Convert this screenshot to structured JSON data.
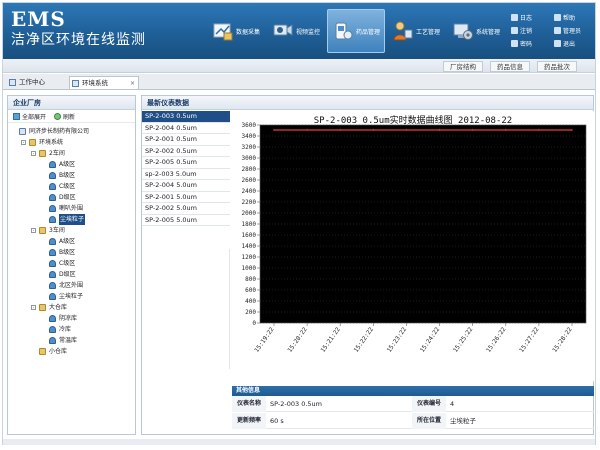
{
  "header": {
    "brand": "EMS",
    "subtitle": "洁净区环境在线监测",
    "modules": [
      {
        "label": "数据采集",
        "icon": "data-collect-icon",
        "active": false
      },
      {
        "label": "视频监控",
        "icon": "video-monitor-icon",
        "active": false
      },
      {
        "label": "药品管理",
        "icon": "drug-manage-icon",
        "active": true
      },
      {
        "label": "工艺管理",
        "icon": "process-manage-icon",
        "active": false
      },
      {
        "label": "系统管理",
        "icon": "system-manage-icon",
        "active": false
      }
    ],
    "utilities": [
      {
        "label": "日志",
        "icon": "log-icon"
      },
      {
        "label": "帮助",
        "icon": "help-icon"
      },
      {
        "label": "注销",
        "icon": "logout-icon"
      },
      {
        "label": "管理员",
        "icon": "admin-icon"
      },
      {
        "label": "密码",
        "icon": "password-icon"
      },
      {
        "label": "退出",
        "icon": "exit-icon"
      }
    ]
  },
  "subtabs": [
    "厂房结构",
    "药品信息",
    "药品批次"
  ],
  "workspace_tabs": [
    {
      "label": "工作中心",
      "active": false
    },
    {
      "label": "环境系统",
      "active": true,
      "close": "×"
    }
  ],
  "left_panel": {
    "title": "企业厂房",
    "expand_all": "全部展开",
    "refresh": "刷新",
    "tree": [
      {
        "label": "同济步长制药有限公司",
        "level": 0,
        "kind": "org",
        "toggle": ""
      },
      {
        "label": "环境系统",
        "level": 1,
        "kind": "folder",
        "toggle": "-"
      },
      {
        "label": "2车间",
        "level": 2,
        "kind": "folder",
        "toggle": "-"
      },
      {
        "label": "A级区",
        "level": 3,
        "kind": "leaf"
      },
      {
        "label": "B级区",
        "level": 3,
        "kind": "leaf"
      },
      {
        "label": "C级区",
        "level": 3,
        "kind": "leaf"
      },
      {
        "label": "D级区",
        "level": 3,
        "kind": "leaf"
      },
      {
        "label": "喇叭外围",
        "level": 3,
        "kind": "leaf"
      },
      {
        "label": "尘埃粒子",
        "level": 3,
        "kind": "leaf",
        "selected": true
      },
      {
        "label": "3车间",
        "level": 2,
        "kind": "folder",
        "toggle": "-"
      },
      {
        "label": "A级区",
        "level": 3,
        "kind": "leaf"
      },
      {
        "label": "B级区",
        "level": 3,
        "kind": "leaf"
      },
      {
        "label": "C级区",
        "level": 3,
        "kind": "leaf"
      },
      {
        "label": "D级区",
        "level": 3,
        "kind": "leaf"
      },
      {
        "label": "北区外围",
        "level": 3,
        "kind": "leaf"
      },
      {
        "label": "尘埃粒子",
        "level": 3,
        "kind": "leaf"
      },
      {
        "label": "大仓库",
        "level": 2,
        "kind": "folder",
        "toggle": "-"
      },
      {
        "label": "阴凉库",
        "level": 3,
        "kind": "leaf"
      },
      {
        "label": "冷库",
        "level": 3,
        "kind": "leaf"
      },
      {
        "label": "常温库",
        "level": 3,
        "kind": "leaf"
      },
      {
        "label": "小仓库",
        "level": 2,
        "kind": "folder",
        "toggle": ""
      }
    ]
  },
  "right_panel": {
    "title": "最新仪表数据",
    "devices": [
      {
        "label": "SP-2-003 0.5um",
        "selected": true
      },
      {
        "label": "SP-2-004 0.5um",
        "selected": false
      },
      {
        "label": "SP-2-001 0.5um",
        "selected": false
      },
      {
        "label": "SP-2-002 0.5um",
        "selected": false
      },
      {
        "label": "SP-2-005 0.5um",
        "selected": false
      },
      {
        "label": "sp-2-003 5.0um",
        "selected": false
      },
      {
        "label": "SP-2-004 5.0um",
        "selected": false
      },
      {
        "label": "SP-2-001 5.0um",
        "selected": false
      },
      {
        "label": "SP-2-002 5.0um",
        "selected": false
      },
      {
        "label": "SP-2-005 5.0um",
        "selected": false
      }
    ]
  },
  "chart_data": {
    "type": "line",
    "title": "SP-2-003 0.5um实时数据曲线图 2012-08-22",
    "xlabel": "",
    "ylabel": "",
    "ylim": [
      0,
      3600
    ],
    "yticks": [
      0,
      200,
      400,
      600,
      800,
      1000,
      1200,
      1400,
      1600,
      1800,
      2000,
      2200,
      2400,
      2600,
      2800,
      3000,
      3200,
      3400,
      3600
    ],
    "xticks": [
      "15:19:22",
      "15:20:22",
      "15:21:22",
      "15:22:22",
      "15:23:22",
      "15:24:22",
      "15:25:22",
      "15:26:22",
      "15:27:22",
      "15:28:22"
    ],
    "plot_background": "#000000",
    "grid": true,
    "series": [
      {
        "color": "#c0392b",
        "x": [
          "15:19:22",
          "15:20:22",
          "15:21:22",
          "15:22:22",
          "15:23:22",
          "15:24:22",
          "15:25:22",
          "15:26:22",
          "15:27:22",
          "15:28:22"
        ],
        "values": [
          3520,
          3520,
          3520,
          3520,
          3520,
          3520,
          3520,
          3520,
          3520,
          3520
        ]
      },
      {
        "color": "#c0392b",
        "x": [
          "15:19:22",
          "15:20:22",
          "15:21:22",
          "15:22:22",
          "15:23:22",
          "15:24:22",
          "15:25:22",
          "15:26:22",
          "15:27:22",
          "15:28:22"
        ],
        "values": [
          3500,
          3500,
          3500,
          3500,
          3500,
          3500,
          3500,
          3500,
          3500,
          3500
        ]
      }
    ]
  },
  "info": {
    "title": "其他信息",
    "rows": [
      [
        {
          "label": "仪表名称",
          "value": "SP-2-003 0.5um"
        },
        {
          "label": "仪表编号",
          "value": "4"
        }
      ],
      [
        {
          "label": "更新频率",
          "value": "60 s"
        },
        {
          "label": "所在位置",
          "value": "尘埃粒子"
        }
      ]
    ]
  },
  "colors": {
    "header_blue": "#1f5f98",
    "selection": "#1f4f86",
    "plot_bg": "#000000",
    "series": "#c0392b"
  }
}
